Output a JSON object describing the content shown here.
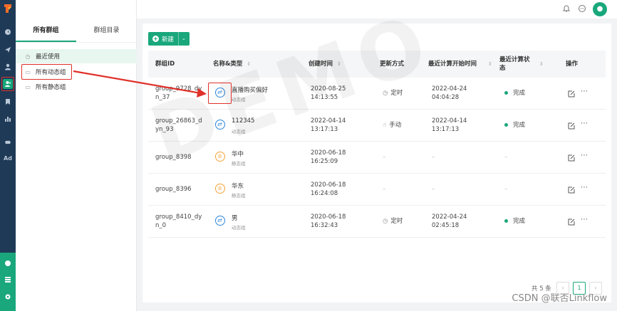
{
  "rail": {
    "ad_label": "Ad"
  },
  "sidebar": {
    "tabs": [
      {
        "label": "所有群组"
      },
      {
        "label": "群组目录"
      }
    ],
    "items": [
      {
        "label": "最近使用",
        "icon": "clock-icon"
      },
      {
        "label": "所有动态组",
        "icon": "folder-icon"
      },
      {
        "label": "所有静态组",
        "icon": "folder-icon"
      }
    ]
  },
  "topbar": {
    "avatar_icon": "user-avatar-icon"
  },
  "toolbar": {
    "new_label": "新建"
  },
  "table": {
    "columns": [
      "群组ID",
      "名称&类型",
      "创建时间",
      "更新方式",
      "最近计算开始时间",
      "最近计算状态",
      "操作"
    ],
    "rows": [
      {
        "id_line1": "group_9728_dy",
        "id_line2": "n_37",
        "name": "直播购买偏好",
        "type": "动态组",
        "kind": "dynamic",
        "created_date": "2020-08-25",
        "created_time": "14:13:55",
        "update": "定时",
        "update_icon": "clock-icon",
        "calc_date": "2022-04-24",
        "calc_time": "04:04:28",
        "status": "完成"
      },
      {
        "id_line1": "group_26863_d",
        "id_line2": "yn_93",
        "name": "112345",
        "type": "动态组",
        "kind": "dynamic",
        "created_date": "2022-04-14",
        "created_time": "13:17:13",
        "update": "手动",
        "update_icon": "hand-icon",
        "calc_date": "2022-04-14",
        "calc_time": "13:17:13",
        "status": "完成"
      },
      {
        "id_line1": "group_8398",
        "id_line2": "",
        "name": "华中",
        "type": "静态组",
        "kind": "static",
        "created_date": "2020-06-18",
        "created_time": "16:25:09",
        "update": "–",
        "update_icon": "",
        "calc_date": "–",
        "calc_time": "",
        "status": "–"
      },
      {
        "id_line1": "group_8396",
        "id_line2": "",
        "name": "华东",
        "type": "静态组",
        "kind": "static",
        "created_date": "2020-06-18",
        "created_time": "16:24:08",
        "update": "–",
        "update_icon": "",
        "calc_date": "–",
        "calc_time": "",
        "status": "–"
      },
      {
        "id_line1": "group_8410_dy",
        "id_line2": "n_0",
        "name": "男",
        "type": "动态组",
        "kind": "dynamic",
        "created_date": "2020-06-18",
        "created_time": "16:32:43",
        "update": "定时",
        "update_icon": "clock-icon",
        "calc_date": "2022-04-24",
        "calc_time": "02:45:18",
        "status": "完成"
      }
    ]
  },
  "pagination": {
    "total": "共 5 条",
    "prev": "‹",
    "current": "1",
    "next": "›"
  },
  "watermark": "DEMO",
  "csdn_watermark": "CSDN @联否Linkflow",
  "colors": {
    "brand": "#19a77b",
    "rail": "#1e3a57",
    "annotation": "#e0302a",
    "dynamic": "#2d86d9",
    "static": "#f2a33a"
  }
}
